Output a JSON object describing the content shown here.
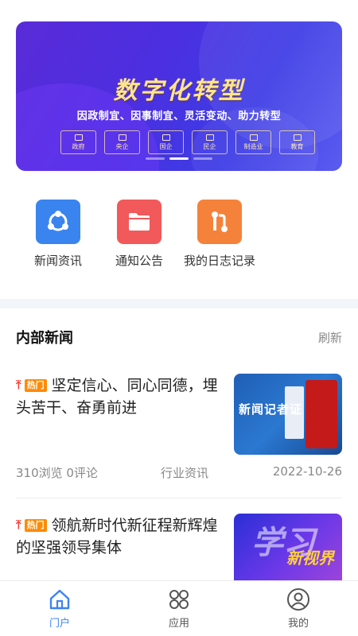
{
  "banner": {
    "title": "数字化转型",
    "subtitle": "因政制宜、因事制宜、灵活变动、助力转型",
    "tags": [
      "政府",
      "央企",
      "国企",
      "民企",
      "制造业",
      "教育"
    ],
    "dots": 3,
    "active_dot": 1
  },
  "quick": [
    {
      "label": "新闻资讯",
      "icon": "share-network-icon",
      "color": "#3a84f0"
    },
    {
      "label": "通知公告",
      "icon": "folder-icon",
      "color": "#f2595a"
    },
    {
      "label": "我的日志记录",
      "icon": "git-compare-icon",
      "color": "#f5823a"
    }
  ],
  "section": {
    "title": "内部新闻",
    "refresh": "刷新"
  },
  "news": [
    {
      "hot": "热门",
      "title": "坚定信心、同心同德，埋头苦干、奋勇前进",
      "views": "310浏览",
      "comments": "0评论",
      "category": "行业资讯",
      "date": "2022-10-26",
      "thumb_text": "新闻记者证"
    },
    {
      "hot": "热门",
      "title": "领航新时代新征程新辉煌的坚强领导集体",
      "thumb_text": "学习",
      "thumb_text2": "新视界"
    }
  ],
  "tabs": [
    {
      "label": "门户",
      "icon": "home-icon",
      "active": true
    },
    {
      "label": "应用",
      "icon": "apps-icon",
      "active": false
    },
    {
      "label": "我的",
      "icon": "user-icon",
      "active": false
    }
  ],
  "colors": {
    "accent": "#3d82f5",
    "hot": "#ff8a00",
    "top": "#ff3b30"
  }
}
